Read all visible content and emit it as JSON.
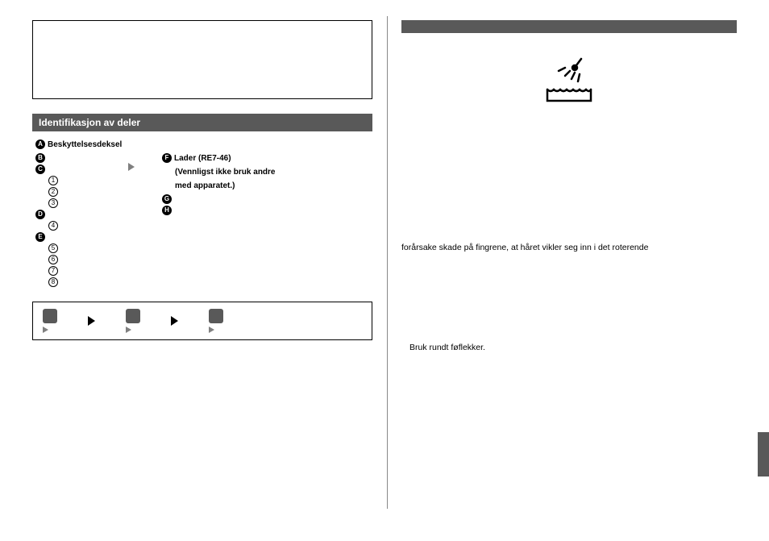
{
  "left": {
    "section_title": "Identifikasjon av deler",
    "parts_left": {
      "A": "Beskyttelsesdeksel",
      "B": "",
      "C": "",
      "n1": "",
      "n2": "",
      "n3": "",
      "D": "",
      "n4": "",
      "E": "",
      "n5": "",
      "n6": "",
      "n7": "",
      "n8": ""
    },
    "parts_right": {
      "F_line1": "Lader (RE7-46)",
      "F_line2": "(Vennligst ikke bruk andre",
      "F_line3": "",
      "F_line4": "med apparatet.)",
      "G": "",
      "H": ""
    }
  },
  "right": {
    "para1_line1": "forårsake skade på fingrene, at håret vikler seg inn i det roterende",
    "para2_line": "Bruk rundt føflekker."
  }
}
